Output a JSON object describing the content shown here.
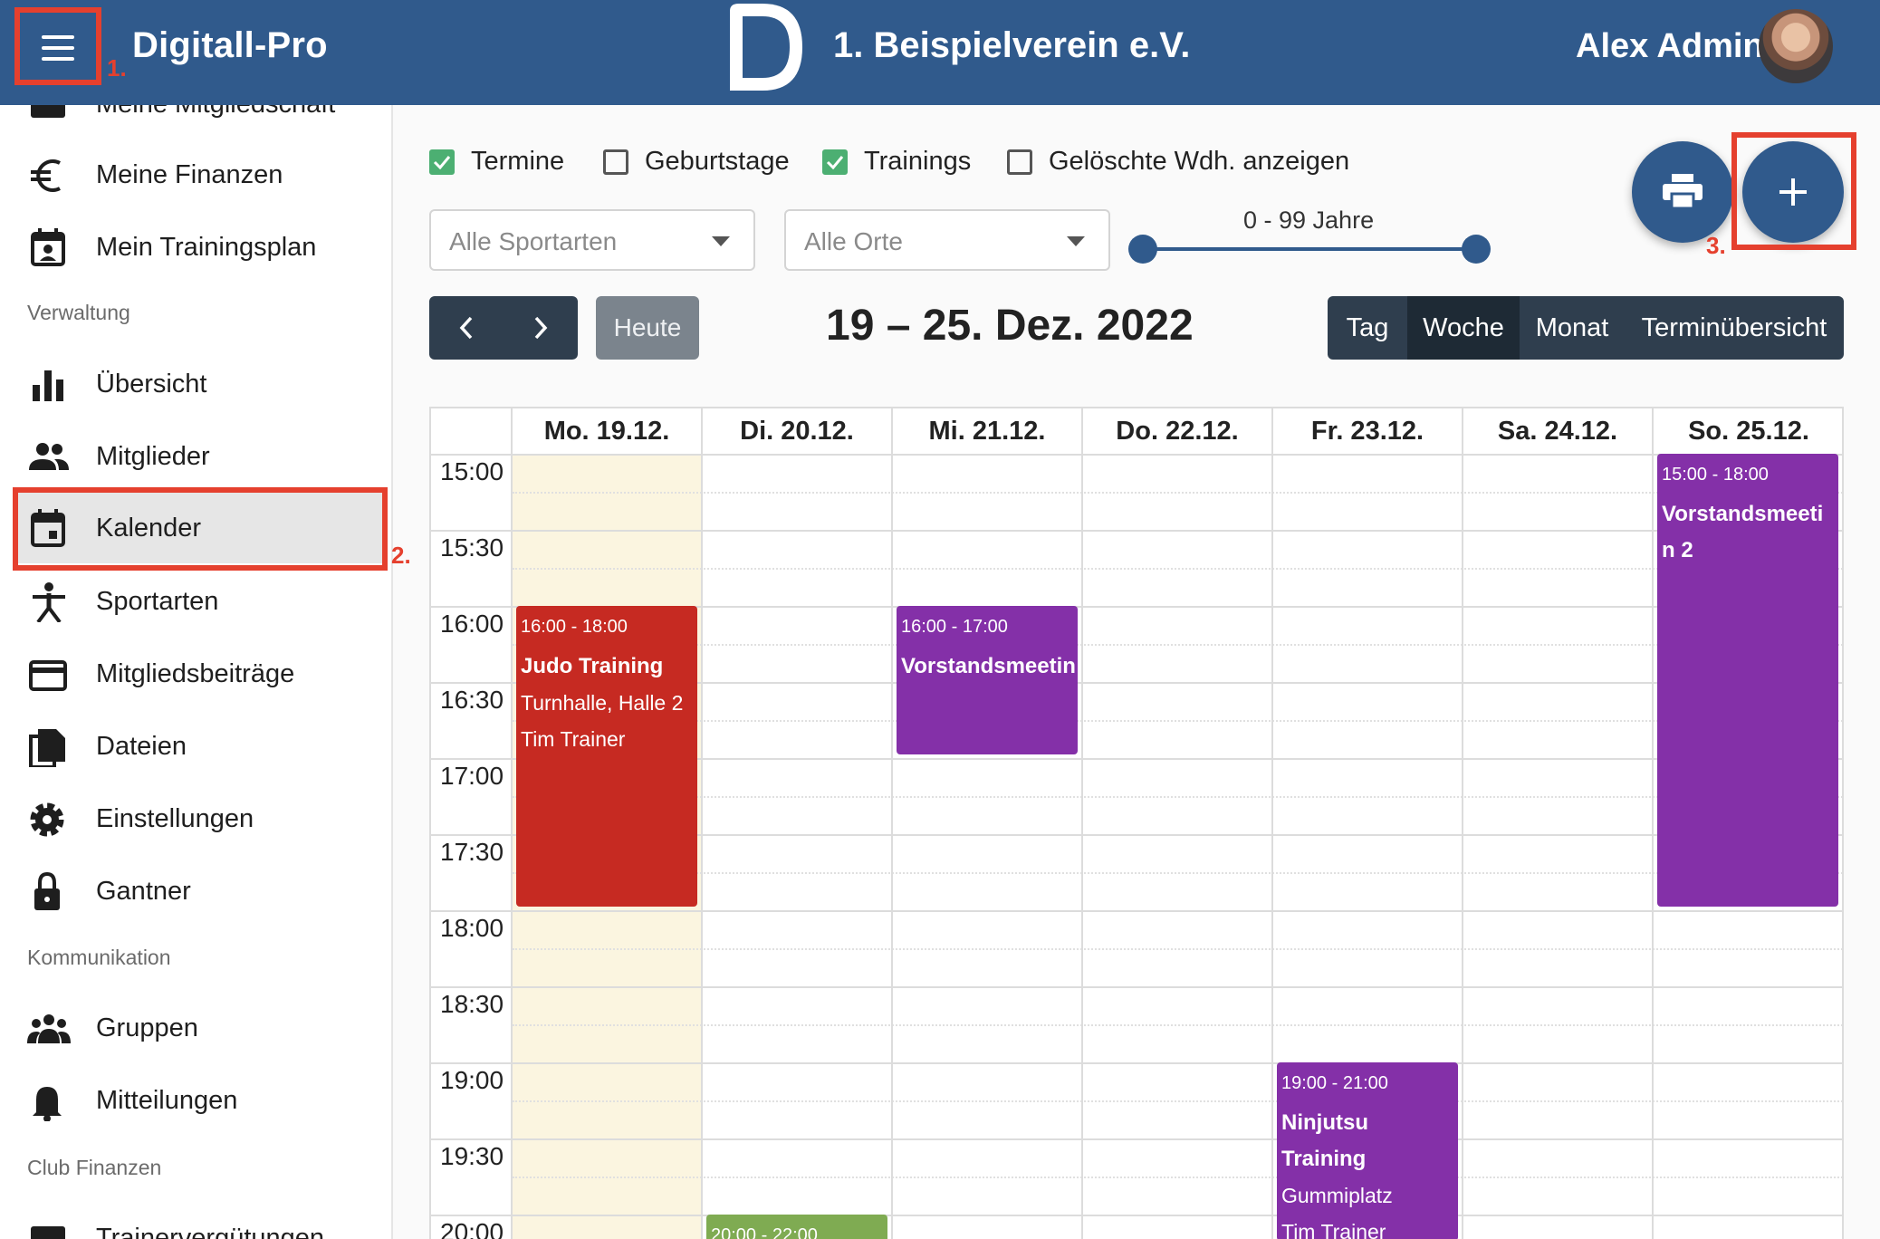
{
  "topbar": {
    "app_title": "Digitall-Pro",
    "club_name": "1. Beispielverein e.V.",
    "user_name": "Alex Admin",
    "annotation_1": "1."
  },
  "sidebar": {
    "partial_top_label": "Meine Mitgliedschaft",
    "items_top": [
      {
        "label": "Meine Finanzen",
        "icon": "euro-icon"
      },
      {
        "label": "Mein Trainingsplan",
        "icon": "calendar-account-icon"
      }
    ],
    "section_verwaltung": "Verwaltung",
    "items_verwaltung": [
      {
        "label": "Übersicht",
        "icon": "bar-chart-icon"
      },
      {
        "label": "Mitglieder",
        "icon": "people-icon"
      },
      {
        "label": "Kalender",
        "icon": "calendar-icon"
      },
      {
        "label": "Sportarten",
        "icon": "sport-figure-icon"
      },
      {
        "label": "Mitgliedsbeiträge",
        "icon": "credit-card-icon"
      },
      {
        "label": "Dateien",
        "icon": "files-icon"
      },
      {
        "label": "Einstellungen",
        "icon": "gear-icon"
      },
      {
        "label": "Gantner",
        "icon": "lock-icon"
      }
    ],
    "section_kommunikation": "Kommunikation",
    "items_kommunikation": [
      {
        "label": "Gruppen",
        "icon": "group-icon"
      },
      {
        "label": "Mitteilungen",
        "icon": "bell-icon"
      }
    ],
    "section_club_finanzen": "Club Finanzen",
    "partial_bottom_label": "Trainervergütungen",
    "annotation_2": "2."
  },
  "filters": {
    "checkboxes": [
      {
        "label": "Termine",
        "checked": true
      },
      {
        "label": "Geburtstage",
        "checked": false
      },
      {
        "label": "Trainings",
        "checked": true
      },
      {
        "label": "Gelöschte Wdh. anzeigen",
        "checked": false
      }
    ],
    "sport_select": "Alle Sportarten",
    "location_select": "Alle Orte",
    "age_range_label": "0 - 99 Jahre",
    "annotation_3": "3."
  },
  "toolbar": {
    "today_label": "Heute",
    "range_title": "19 – 25. Dez. 2022",
    "views": [
      "Tag",
      "Woche",
      "Monat",
      "Terminübersicht"
    ],
    "active_view": "Woche"
  },
  "calendar": {
    "days": [
      "Mo. 19.12.",
      "Di. 20.12.",
      "Mi. 21.12.",
      "Do. 22.12.",
      "Fr. 23.12.",
      "Sa. 24.12.",
      "So. 25.12."
    ],
    "times": [
      "15:00",
      "15:30",
      "16:00",
      "16:30",
      "17:00",
      "17:30",
      "18:00",
      "18:30",
      "19:00",
      "19:30",
      "20:00"
    ],
    "events": [
      {
        "time": "16:00 - 18:00",
        "title": "Judo Training",
        "location": "Turnhalle, Halle 2",
        "trainer": "Tim Trainer",
        "color": "#c62a22"
      },
      {
        "time": "16:00 - 17:00",
        "title": "Vorstandsmeetin",
        "color": "#8430a8"
      },
      {
        "time": "15:00 - 18:00",
        "title": "Vorstandsmeetin 2",
        "color": "#8430a8"
      },
      {
        "time": "19:00 - 21:00",
        "title": "Ninjutsu Training",
        "location": "Gummiplatz",
        "trainer": "Tim Trainer",
        "color": "#8430a8"
      },
      {
        "time": "20:00 - 22:00",
        "color": "#7fab52"
      }
    ]
  },
  "colors": {
    "primary": "#305a8c",
    "annotation_red": "#e5402e",
    "today_bg": "#fbf5e0"
  }
}
